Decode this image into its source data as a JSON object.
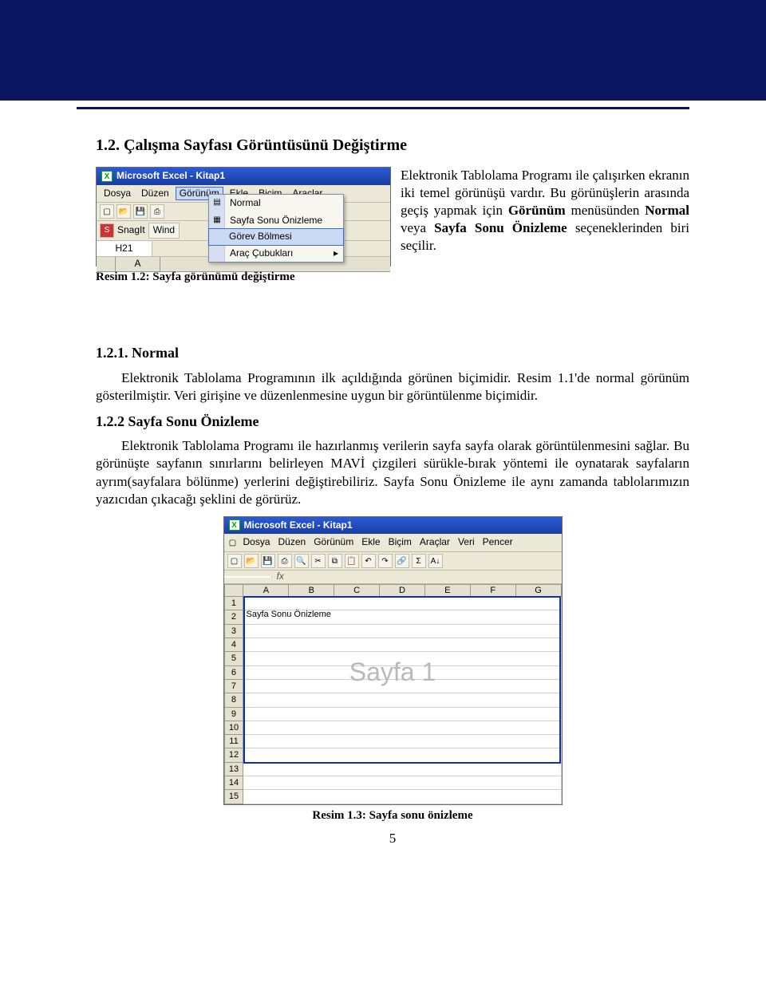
{
  "page_number": "5",
  "headings": {
    "h2": "1.2. Çalışma Sayfası Görüntüsünü Değiştirme",
    "h3a": "1.2.1. Normal",
    "h3b": "1.2.2 Sayfa Sonu Önizleme"
  },
  "side_paragraph": {
    "pre": "Elektronik Tablolama Programı ile çalışırken ekranın iki temel görünüşü vardır. Bu görünüşlerin arasında geçiş yapmak için ",
    "bold1": "Görünüm",
    "mid1": " menüsünden ",
    "bold2": "Normal",
    "mid2": " veya ",
    "bold3": "Sayfa Sonu Önizleme",
    "post": " seçeneklerinden biri seçilir."
  },
  "captions": {
    "c1": "Resim 1.2: Sayfa görünümü değiştirme",
    "c2": "Resim 1.3: Sayfa sonu önizleme"
  },
  "para_normal": "Elektronik Tablolama Programının ilk açıldığında görünen biçimidir. Resim 1.1'de normal görünüm gösterilmiştir. Veri girişine ve düzenlenmesine uygun bir görüntülenme biçimidir.",
  "para_sso": "Elektronik Tablolama Programı ile hazırlanmış verilerin sayfa sayfa olarak görüntülenmesini sağlar. Bu görünüşte sayfanın sınırlarını belirleyen MAVİ çizgileri sürükle-bırak yöntemi ile oynatarak sayfaların ayrım(sayfalara bölünme) yerlerini değiştirebiliriz. Sayfa Sonu Önizleme ile aynı zamanda tablolarımızın yazıcıdan çıkacağı şeklini de görürüz.",
  "shot1": {
    "title": "Microsoft Excel - Kitap1",
    "menus": [
      "Dosya",
      "Düzen",
      "Görünüm",
      "Ekle",
      "Biçim",
      "Araçlar"
    ],
    "snag": "SnagIt",
    "snag_dd": "Wind",
    "cellref": "H21",
    "colA": "A",
    "popup": [
      "Normal",
      "Sayfa Sonu Önizleme",
      "Görev Bölmesi",
      "Araç Çubukları"
    ],
    "icon_label": "X"
  },
  "shot2": {
    "title": "Microsoft Excel - Kitap1",
    "menus": [
      "Dosya",
      "Düzen",
      "Görünüm",
      "Ekle",
      "Biçim",
      "Araçlar",
      "Veri",
      "Pencer"
    ],
    "fx": "fx",
    "cols": [
      "A",
      "B",
      "C",
      "D",
      "E",
      "F",
      "G"
    ],
    "rows": [
      "1",
      "2",
      "3",
      "4",
      "5",
      "6",
      "7",
      "8",
      "9",
      "10",
      "11",
      "12",
      "13",
      "14",
      "15"
    ],
    "a2": "Sayfa Sonu Önizleme",
    "watermark": "Sayfa 1"
  }
}
